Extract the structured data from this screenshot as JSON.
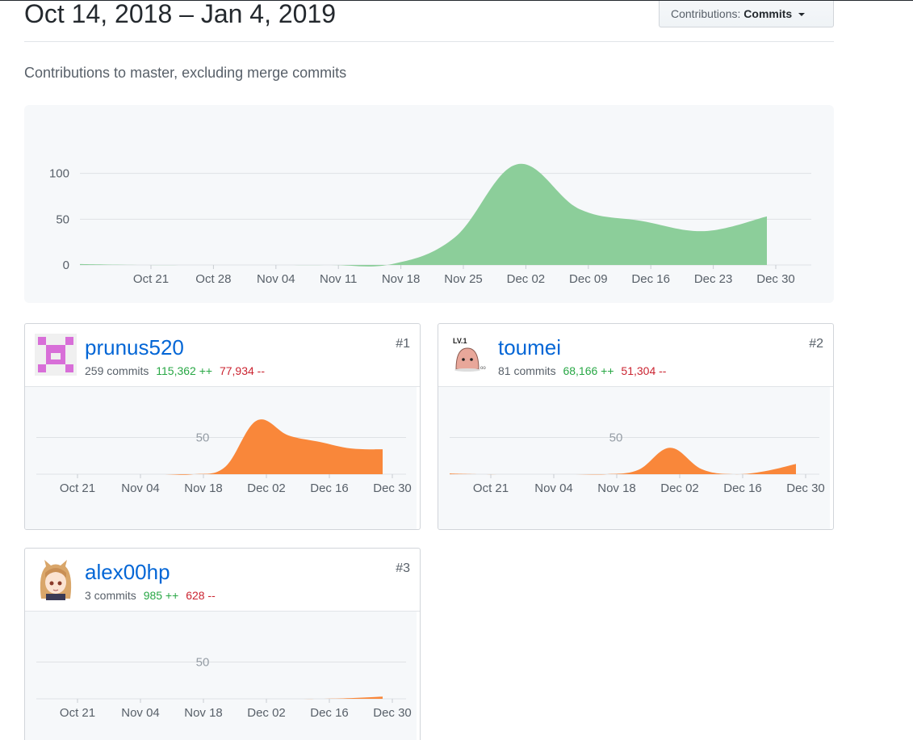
{
  "header": {
    "date_range": "Oct 14, 2018 – Jan 4, 2019",
    "contributions_label": "Contributions:",
    "contributions_value": "Commits"
  },
  "subtitle": "Contributions to master, excluding merge commits",
  "main_chart": {
    "y_ticks": [
      "100",
      "50",
      "0"
    ],
    "x_ticks": [
      "Oct 21",
      "Oct 28",
      "Nov 04",
      "Nov 11",
      "Nov 18",
      "Nov 25",
      "Dec 02",
      "Dec 09",
      "Dec 16",
      "Dec 23",
      "Dec 30"
    ],
    "color": "#8cce9a"
  },
  "contributors": [
    {
      "rank": "#1",
      "name": "prunus520",
      "commits": "259 commits",
      "additions": "115,362 ++",
      "deletions": "77,934 --",
      "y_tick": "50",
      "x_ticks": [
        "Oct 21",
        "Nov 04",
        "Nov 18",
        "Dec 02",
        "Dec 16",
        "Dec 30"
      ]
    },
    {
      "rank": "#2",
      "name": "toumei",
      "commits": "81 commits",
      "additions": "68,166 ++",
      "deletions": "51,304 --",
      "y_tick": "50",
      "x_ticks": [
        "Oct 21",
        "Nov 04",
        "Nov 18",
        "Dec 02",
        "Dec 16",
        "Dec 30"
      ]
    },
    {
      "rank": "#3",
      "name": "alex00hp",
      "commits": "3 commits",
      "additions": "985 ++",
      "deletions": "628 --",
      "y_tick": "50",
      "x_ticks": [
        "Oct 21",
        "Nov 04",
        "Nov 18",
        "Dec 02",
        "Dec 16",
        "Dec 30"
      ]
    }
  ],
  "colors": {
    "accent": "#0366d6",
    "added": "#28a745",
    "deleted": "#cb2431",
    "contributor_area": "#f9873a"
  },
  "chart_data": [
    {
      "type": "area",
      "x": [
        "Oct 14",
        "Oct 21",
        "Oct 28",
        "Nov 04",
        "Nov 11",
        "Nov 18",
        "Nov 25",
        "Dec 02",
        "Dec 09",
        "Dec 16",
        "Dec 23",
        "Dec 30"
      ],
      "values": [
        1,
        0,
        0,
        0,
        0,
        1,
        30,
        110,
        61,
        48,
        37,
        53
      ],
      "ylim": [
        0,
        120
      ],
      "yticks": [
        0,
        50,
        100
      ],
      "grid": true
    },
    {
      "type": "area",
      "x": [
        "Oct 14",
        "Oct 21",
        "Oct 28",
        "Nov 04",
        "Nov 11",
        "Nov 18",
        "Nov 25",
        "Dec 02",
        "Dec 09",
        "Dec 16",
        "Dec 23",
        "Dec 30"
      ],
      "values": [
        0,
        0,
        0,
        0,
        0,
        0,
        10,
        73,
        53,
        44,
        35,
        34
      ],
      "ylim": [
        0,
        110
      ]
    },
    {
      "type": "area",
      "x": [
        "Oct 14",
        "Oct 21",
        "Oct 28",
        "Nov 04",
        "Nov 11",
        "Nov 18",
        "Nov 25",
        "Dec 02",
        "Dec 09",
        "Dec 16",
        "Dec 23",
        "Dec 30"
      ],
      "values": [
        1,
        0,
        0,
        0,
        0,
        0,
        6,
        36,
        7,
        0,
        4,
        14
      ],
      "ylim": [
        0,
        110
      ]
    },
    {
      "type": "area",
      "x": [
        "Oct 14",
        "Oct 21",
        "Oct 28",
        "Nov 04",
        "Nov 11",
        "Nov 18",
        "Nov 25",
        "Dec 02",
        "Dec 09",
        "Dec 16",
        "Dec 23",
        "Dec 30"
      ],
      "values": [
        0,
        0,
        0,
        0,
        0,
        0,
        0,
        0,
        0,
        0,
        1,
        3
      ],
      "ylim": [
        0,
        110
      ]
    }
  ]
}
